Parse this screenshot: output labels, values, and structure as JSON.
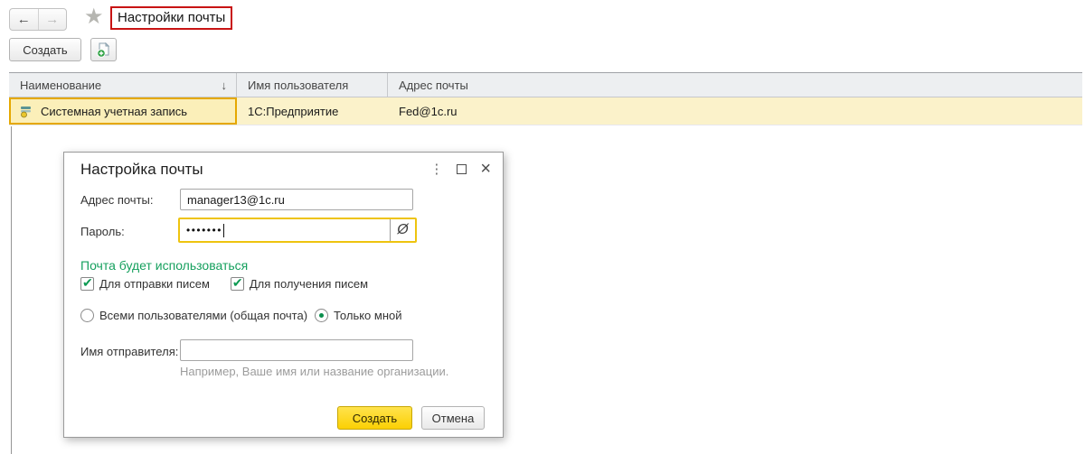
{
  "nav": {
    "back_icon": "←",
    "forward_icon": "→",
    "star_icon": "★",
    "page_title": "Настройки почты"
  },
  "command_bar": {
    "create_button": "Создать"
  },
  "table": {
    "columns": [
      {
        "label": "Наименование",
        "sort_icon": "↓"
      },
      {
        "label": "Имя пользователя"
      },
      {
        "label": "Адрес почты"
      }
    ],
    "rows": [
      {
        "name": "Системная учетная запись",
        "user_name": "1С:Предприятие",
        "email": "Fed@1c.ru"
      }
    ]
  },
  "dialog": {
    "title": "Настройка почты",
    "window_controls": {
      "menu_icon": "⋮",
      "close_icon": "×"
    },
    "email": {
      "label": "Адрес почты:",
      "value": "manager13@1c.ru"
    },
    "password": {
      "label": "Пароль:",
      "value": "•••••••",
      "eye_icon": "Ø"
    },
    "usage": {
      "heading": "Почта будет использоваться",
      "checkboxes": [
        {
          "label": "Для отправки писем",
          "checked": true,
          "mark": "✔"
        },
        {
          "label": "Для получения писем",
          "checked": true,
          "mark": "✔"
        }
      ],
      "radios": [
        {
          "label": "Всеми пользователями (общая почта)",
          "selected": false
        },
        {
          "label": "Только мной",
          "selected": true
        }
      ]
    },
    "sender": {
      "label": "Имя отправителя:",
      "value": "",
      "hint": "Например, Ваше имя или название организации."
    },
    "footer": {
      "create_button": "Создать",
      "cancel_button": "Отмена"
    }
  },
  "colors": {
    "accent_yellow": "#fbd003",
    "row_highlight": "#fbf2ca",
    "selected_cell_border": "#e5a800",
    "green_heading": "#16a05e",
    "annotation_red": "#c81414",
    "focus_border": "#eec40f"
  }
}
